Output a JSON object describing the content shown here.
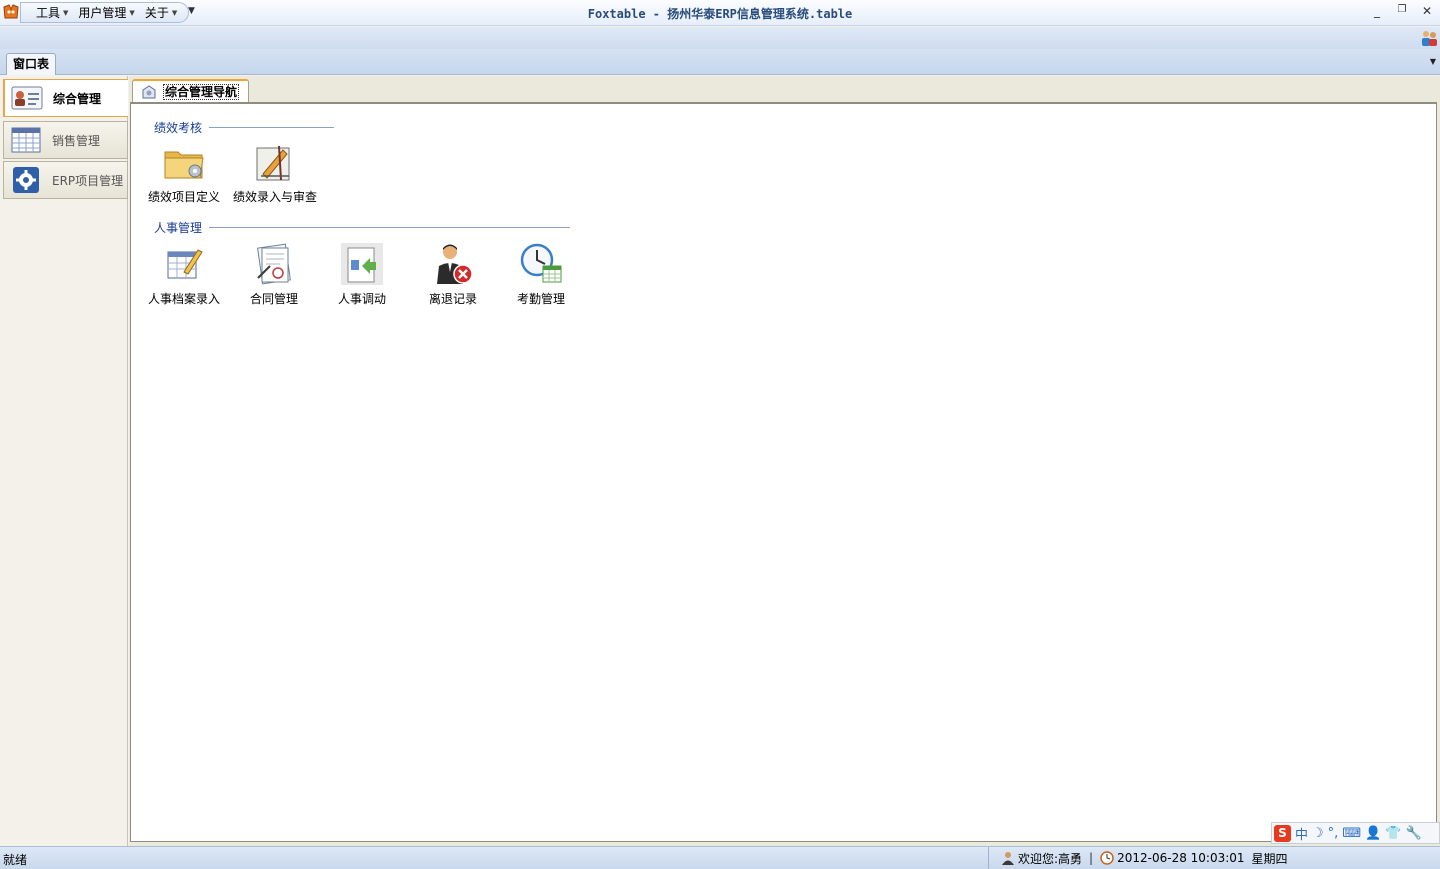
{
  "title_bar": {
    "title": "Foxtable - 扬州华泰ERP信息管理系统.table",
    "menus": [
      {
        "label": "工具"
      },
      {
        "label": "用户管理"
      },
      {
        "label": "关于"
      }
    ],
    "min_glyph": "_",
    "restore_glyph": "❐",
    "close_glyph": "✕",
    "qat_more_glyph": "▼"
  },
  "window_tabs": {
    "active_label": "窗口表",
    "dropdown_glyph": "▼"
  },
  "nav": {
    "items": [
      {
        "label": "综合管理",
        "icon": "contact-card-icon",
        "active": true
      },
      {
        "label": "销售管理",
        "icon": "calendar-grid-icon",
        "active": false
      },
      {
        "label": "ERP项目管理",
        "icon": "gear-icon",
        "active": false
      }
    ]
  },
  "doc_tab": {
    "label": "综合管理导航",
    "icon": "navigation-icon"
  },
  "groups": [
    {
      "title": "绩效考核",
      "items": [
        {
          "label": "绩效项目定义",
          "icon": "folder-gear-icon"
        },
        {
          "label": "绩效录入与审查",
          "icon": "drafting-tools-icon"
        }
      ]
    },
    {
      "title": "人事管理",
      "items": [
        {
          "label": "人事档案录入",
          "icon": "table-pencil-icon"
        },
        {
          "label": "合同管理",
          "icon": "contract-icon"
        },
        {
          "label": "人事调动",
          "icon": "document-transfer-icon"
        },
        {
          "label": "离退记录",
          "icon": "person-remove-icon"
        },
        {
          "label": "考勤管理",
          "icon": "clock-calendar-icon"
        }
      ]
    }
  ],
  "ime_toolbar": {
    "logo": "S",
    "mode": "中",
    "glyphs": [
      "☽",
      "°,",
      "⌨",
      "👤",
      "👕",
      "🔧"
    ]
  },
  "status_bar": {
    "status": "就绪",
    "welcome": "欢迎您:高勇",
    "separator": "|",
    "datetime": "2012-06-28 10:03:01",
    "weekday": "星期四"
  }
}
